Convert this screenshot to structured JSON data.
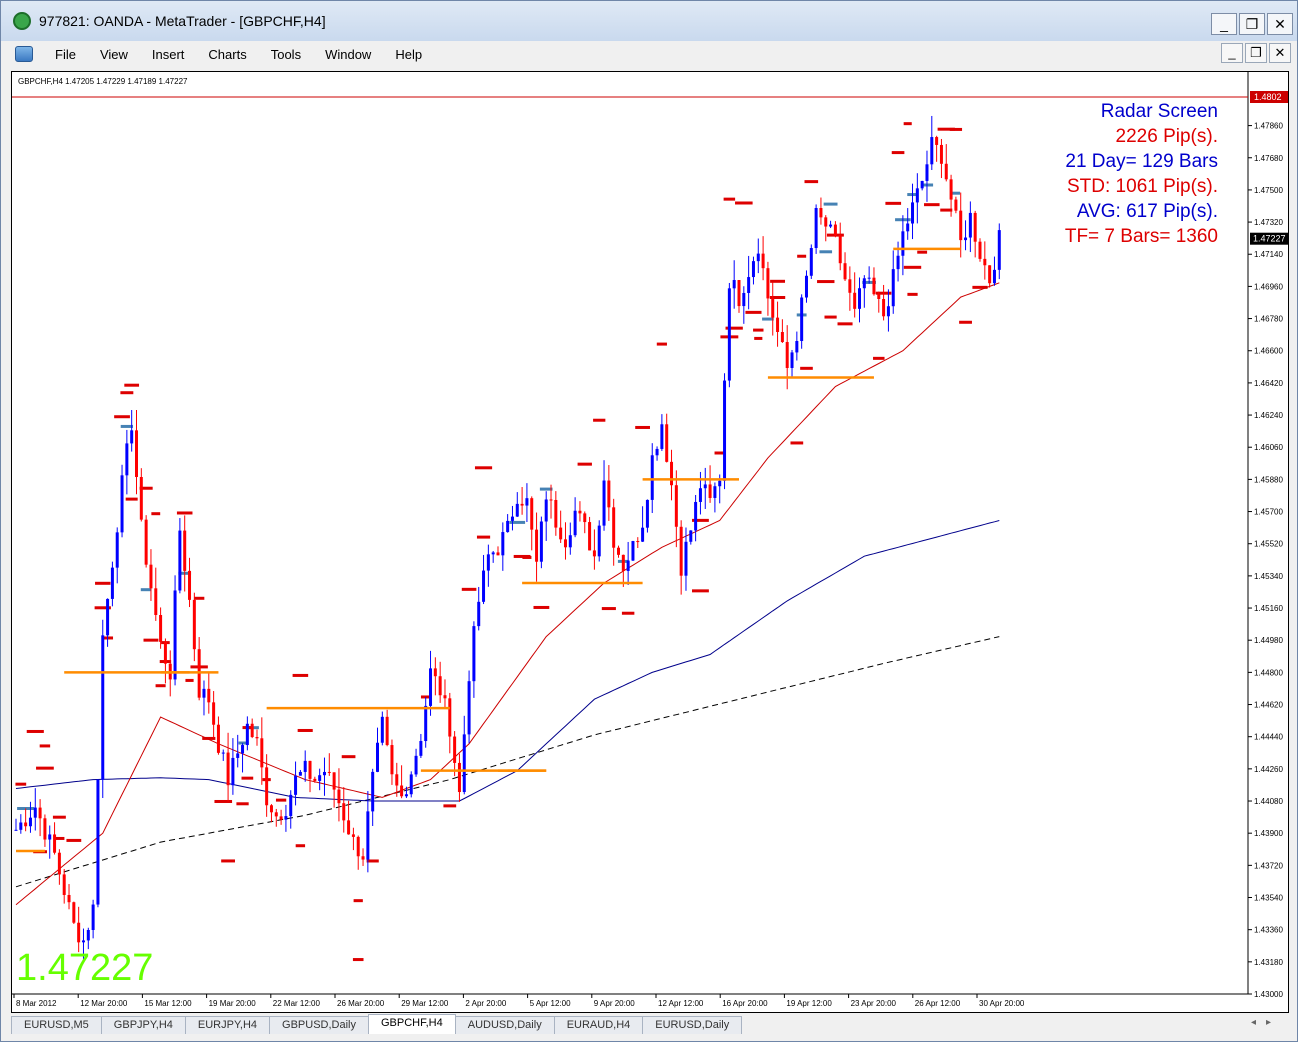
{
  "window": {
    "title": "977821: OANDA - MetaTrader - [GBPCHF,H4]",
    "minimize": "_",
    "restore": "❐",
    "close": "✕"
  },
  "menu": [
    "File",
    "View",
    "Insert",
    "Charts",
    "Tools",
    "Window",
    "Help"
  ],
  "chart": {
    "header": "GBPCHF,H4  1.47205 1.47229 1.47189 1.47227",
    "big_price": "1.47227",
    "current_price_label": "1.47227",
    "top_line_label": "1.4802",
    "radar": [
      "Radar Screen",
      "2226 Pip(s).",
      "21 Day= 129 Bars",
      "STD: 1061 Pip(s).",
      "AVG: 617 Pip(s).",
      "TF= 7 Bars= 1360"
    ],
    "colors": {
      "up": "#0000ff",
      "down": "#ff0000",
      "ma_fast": "#cc0000",
      "ma_slow": "#00008b",
      "ma_long": "#000000",
      "level": "#ff8c00",
      "marker_red": "#dd0000",
      "marker_blue": "#4682b4",
      "big_price": "#66ff00"
    }
  },
  "chart_data": {
    "type": "candlestick",
    "symbol": "GBPCHF",
    "timeframe": "H4",
    "y_ticks": [
      "1.47860",
      "1.47680",
      "1.47500",
      "1.47320",
      "1.47140",
      "1.46960",
      "1.46780",
      "1.46600",
      "1.46420",
      "1.46240",
      "1.46060",
      "1.45880",
      "1.45700",
      "1.45520",
      "1.45340",
      "1.45160",
      "1.44980",
      "1.44800",
      "1.44620",
      "1.44440",
      "1.44260",
      "1.44080",
      "1.43900",
      "1.43720",
      "1.43540",
      "1.43360",
      "1.43180",
      "1.43000"
    ],
    "x_ticks": [
      "8 Mar 2012",
      "12 Mar 20:00",
      "15 Mar 12:00",
      "19 Mar 20:00",
      "22 Mar 12:00",
      "26 Mar 20:00",
      "29 Mar 12:00",
      "2 Apr 20:00",
      "5 Apr 12:00",
      "9 Apr 20:00",
      "12 Apr 12:00",
      "16 Apr 20:00",
      "19 Apr 12:00",
      "23 Apr 20:00",
      "26 Apr 12:00",
      "30 Apr 20:00"
    ],
    "ylim": [
      1.43,
      1.4802
    ],
    "anchors": [
      [
        0,
        1.4392
      ],
      [
        4,
        1.4405
      ],
      [
        8,
        1.4378
      ],
      [
        12,
        1.4338
      ],
      [
        14,
        1.433
      ],
      [
        16,
        1.4348
      ],
      [
        18,
        1.45
      ],
      [
        22,
        1.4585
      ],
      [
        24,
        1.462
      ],
      [
        26,
        1.456
      ],
      [
        28,
        1.4528
      ],
      [
        30,
        1.4495
      ],
      [
        32,
        1.448
      ],
      [
        34,
        1.456
      ],
      [
        36,
        1.452
      ],
      [
        38,
        1.447
      ],
      [
        40,
        1.4465
      ],
      [
        42,
        1.444
      ],
      [
        44,
        1.442
      ],
      [
        46,
        1.4435
      ],
      [
        48,
        1.445
      ],
      [
        50,
        1.444
      ],
      [
        52,
        1.441
      ],
      [
        54,
        1.44
      ],
      [
        56,
        1.4405
      ],
      [
        58,
        1.442
      ],
      [
        60,
        1.4425
      ],
      [
        62,
        1.442
      ],
      [
        64,
        1.4425
      ],
      [
        66,
        1.4415
      ],
      [
        68,
        1.44
      ],
      [
        70,
        1.4385
      ],
      [
        72,
        1.4378
      ],
      [
        74,
        1.442
      ],
      [
        76,
        1.445
      ],
      [
        78,
        1.442
      ],
      [
        80,
        1.441
      ],
      [
        82,
        1.4425
      ],
      [
        84,
        1.4445
      ],
      [
        86,
        1.448
      ],
      [
        88,
        1.447
      ],
      [
        90,
        1.445
      ],
      [
        92,
        1.4412
      ],
      [
        94,
        1.448
      ],
      [
        96,
        1.452
      ],
      [
        98,
        1.4545
      ],
      [
        100,
        1.455
      ],
      [
        102,
        1.456
      ],
      [
        104,
        1.458
      ],
      [
        106,
        1.4575
      ],
      [
        108,
        1.454
      ],
      [
        110,
        1.458
      ],
      [
        112,
        1.4565
      ],
      [
        114,
        1.4555
      ],
      [
        116,
        1.457
      ],
      [
        118,
        1.456
      ],
      [
        120,
        1.4545
      ],
      [
        122,
        1.459
      ],
      [
        124,
        1.4555
      ],
      [
        126,
        1.454
      ],
      [
        128,
        1.455
      ],
      [
        130,
        1.4565
      ],
      [
        132,
        1.46
      ],
      [
        134,
        1.462
      ],
      [
        136,
        1.4585
      ],
      [
        138,
        1.454
      ],
      [
        140,
        1.456
      ],
      [
        142,
        1.4585
      ],
      [
        144,
        1.4575
      ],
      [
        146,
        1.459
      ],
      [
        148,
        1.47
      ],
      [
        150,
        1.469
      ],
      [
        152,
        1.4705
      ],
      [
        154,
        1.472
      ],
      [
        156,
        1.469
      ],
      [
        158,
        1.467
      ],
      [
        160,
        1.465
      ],
      [
        162,
        1.467
      ],
      [
        164,
        1.47
      ],
      [
        166,
        1.4735
      ],
      [
        168,
        1.473
      ],
      [
        170,
        1.472
      ],
      [
        172,
        1.47
      ],
      [
        174,
        1.468
      ],
      [
        176,
        1.47
      ],
      [
        178,
        1.469
      ],
      [
        180,
        1.468
      ],
      [
        182,
        1.47
      ],
      [
        184,
        1.4725
      ],
      [
        186,
        1.474
      ],
      [
        188,
        1.4755
      ],
      [
        190,
        1.4775
      ],
      [
        192,
        1.477
      ],
      [
        194,
        1.4745
      ],
      [
        196,
        1.472
      ],
      [
        198,
        1.4735
      ],
      [
        200,
        1.4715
      ],
      [
        202,
        1.47
      ],
      [
        204,
        1.4722
      ]
    ],
    "ma_fast": [
      [
        0,
        1.435
      ],
      [
        18,
        1.439
      ],
      [
        30,
        1.4455
      ],
      [
        42,
        1.444
      ],
      [
        60,
        1.442
      ],
      [
        76,
        1.441
      ],
      [
        86,
        1.442
      ],
      [
        94,
        1.444
      ],
      [
        110,
        1.45
      ],
      [
        122,
        1.453
      ],
      [
        134,
        1.455
      ],
      [
        146,
        1.4565
      ],
      [
        156,
        1.46
      ],
      [
        170,
        1.464
      ],
      [
        184,
        1.466
      ],
      [
        196,
        1.469
      ],
      [
        204,
        1.4698
      ]
    ],
    "ma_slow": [
      [
        0,
        1.4415
      ],
      [
        16,
        1.442
      ],
      [
        30,
        1.4421
      ],
      [
        40,
        1.442
      ],
      [
        58,
        1.441
      ],
      [
        74,
        1.4408
      ],
      [
        92,
        1.4408
      ],
      [
        104,
        1.4425
      ],
      [
        120,
        1.4465
      ],
      [
        132,
        1.448
      ],
      [
        144,
        1.449
      ],
      [
        160,
        1.452
      ],
      [
        176,
        1.4545
      ],
      [
        190,
        1.4555
      ],
      [
        204,
        1.4565
      ]
    ],
    "ma_long": [
      [
        0,
        1.436
      ],
      [
        30,
        1.4385
      ],
      [
        60,
        1.44
      ],
      [
        90,
        1.442
      ],
      [
        120,
        1.4445
      ],
      [
        150,
        1.4465
      ],
      [
        180,
        1.4485
      ],
      [
        204,
        1.45
      ]
    ],
    "levels": [
      [
        10,
        36,
        1.448
      ],
      [
        52,
        90,
        1.446
      ],
      [
        102,
        110,
        1.4425
      ],
      [
        84,
        104,
        1.4425
      ],
      [
        100,
        110,
        1.4425
      ],
      [
        105,
        130,
        1.453
      ],
      [
        130,
        150,
        1.4588
      ],
      [
        156,
        178,
        1.4645
      ],
      [
        182,
        196,
        1.4717
      ],
      [
        0,
        6,
        1.438
      ],
      [
        30,
        42,
        1.448
      ]
    ]
  },
  "tabs": [
    "EURUSD,M5",
    "GBPJPY,H4",
    "EURJPY,H4",
    "GBPUSD,Daily",
    "GBPCHF,H4",
    "AUDUSD,Daily",
    "EURAUD,H4",
    "EURUSD,Daily"
  ],
  "active_tab": "GBPCHF,H4"
}
